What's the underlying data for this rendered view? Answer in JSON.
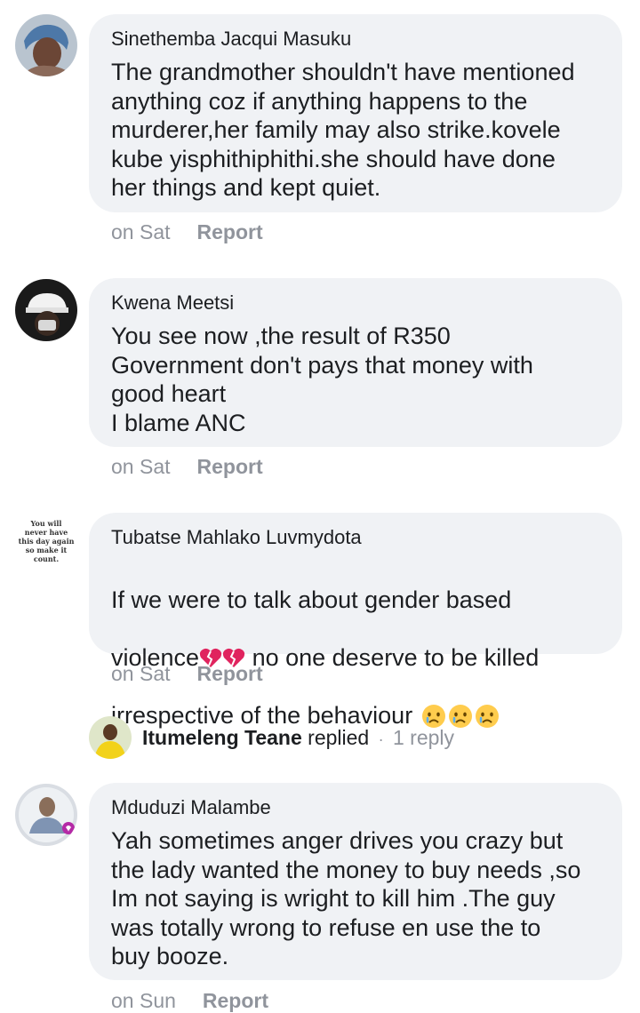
{
  "comments": [
    {
      "author": "Sinethemba Jacqui Masuku",
      "text": "The grandmother shouldn't have mentioned\nanything coz if anything happens to the\nmurderer,her family may also strike.kovele\nkube yisphithiphithi.she should have done\nher things and kept quiet.",
      "time": "on Sat",
      "report": "Report"
    },
    {
      "author": "Kwena Meetsi",
      "text": "You see now ,the result of R350\nGovernment don't pays that money with\ngood heart\nI blame ANC",
      "time": "on Sat",
      "report": "Report"
    },
    {
      "author": "Tubatse Mahlako Luvmydota",
      "text_line1": "If we were to talk about gender based",
      "text_line2a": "violence",
      "text_line2b": " no one deserve to be killed",
      "text_line3": "irrespective of the behaviour ",
      "time": "on Sat",
      "report": "Report",
      "avatar_text": "You will never have this day again so make it count."
    },
    {
      "author": "Mduduzi Malambe",
      "text": "Yah sometimes anger drives you crazy but\nthe lady wanted the money to buy needs ,so\nIm not saying is wright to kill him .The guy\nwas totally wrong to refuse en use the to\nbuy booze.",
      "time": "on Sun",
      "report": "Report"
    }
  ],
  "reply": {
    "name": "Itumeleng Teane",
    "action": "replied",
    "separator": "·",
    "count": "1 reply"
  },
  "colors": {
    "bubble": "#f0f2f5",
    "meta": "#90949c",
    "text": "#1c1e21"
  },
  "icons": [
    "broken-heart-icon",
    "crying-face-icon"
  ]
}
